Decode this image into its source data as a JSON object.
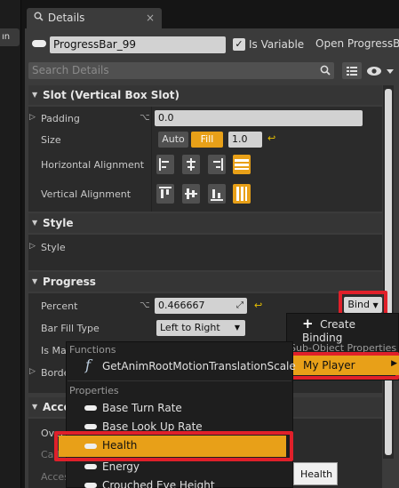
{
  "left_strip": {
    "tab_fragment": "ın"
  },
  "tab": {
    "icon": "search-icon",
    "label": "Details",
    "close": "×"
  },
  "top": {
    "widget_name": "ProgressBar_99",
    "is_variable_label": "Is Variable",
    "open_link": "Open ProgressB",
    "search_placeholder": "Search Details"
  },
  "sections": {
    "slot": "Slot (Vertical Box Slot)",
    "style": "Style",
    "progress": "Progress"
  },
  "slot": {
    "padding_label": "Padding",
    "padding_value": "0.0",
    "size_label": "Size",
    "size_auto": "Auto",
    "size_fill": "Fill",
    "size_value": "1.0",
    "halign_label": "Horizontal Alignment",
    "valign_label": "Vertical Alignment"
  },
  "style": {
    "style_label": "Style"
  },
  "progress": {
    "percent_label": "Percent",
    "percent_value": "0.466667",
    "bind_label": "Bind",
    "bar_fill_label": "Bar Fill Type",
    "bar_fill_value": "Left to Right",
    "is_ma_label": "Is Ma",
    "border_label": "Borde",
    "acce_label": "Acce",
    "over_label": "Over",
    "call_label": "Call",
    "acces_label": "Acces"
  },
  "bind_menu": {
    "create_binding": "Create Binding",
    "sub_object_header": "Sub-Object Properties",
    "my_player": "My Player"
  },
  "func_menu": {
    "functions_header": "Functions",
    "function_item": "GetAnimRootMotionTranslationScale",
    "properties_header": "Properties",
    "items": [
      "Base Turn Rate",
      "Base Look Up Rate",
      "Health",
      "Energy",
      "Crouched Eye Height"
    ]
  },
  "tooltip": {
    "text": "Health"
  },
  "colors": {
    "accent": "#e8a018",
    "highlight_border": "#e0202a",
    "panel_bg": "#3b3b3b",
    "menu_bg": "#1e1e1e"
  }
}
